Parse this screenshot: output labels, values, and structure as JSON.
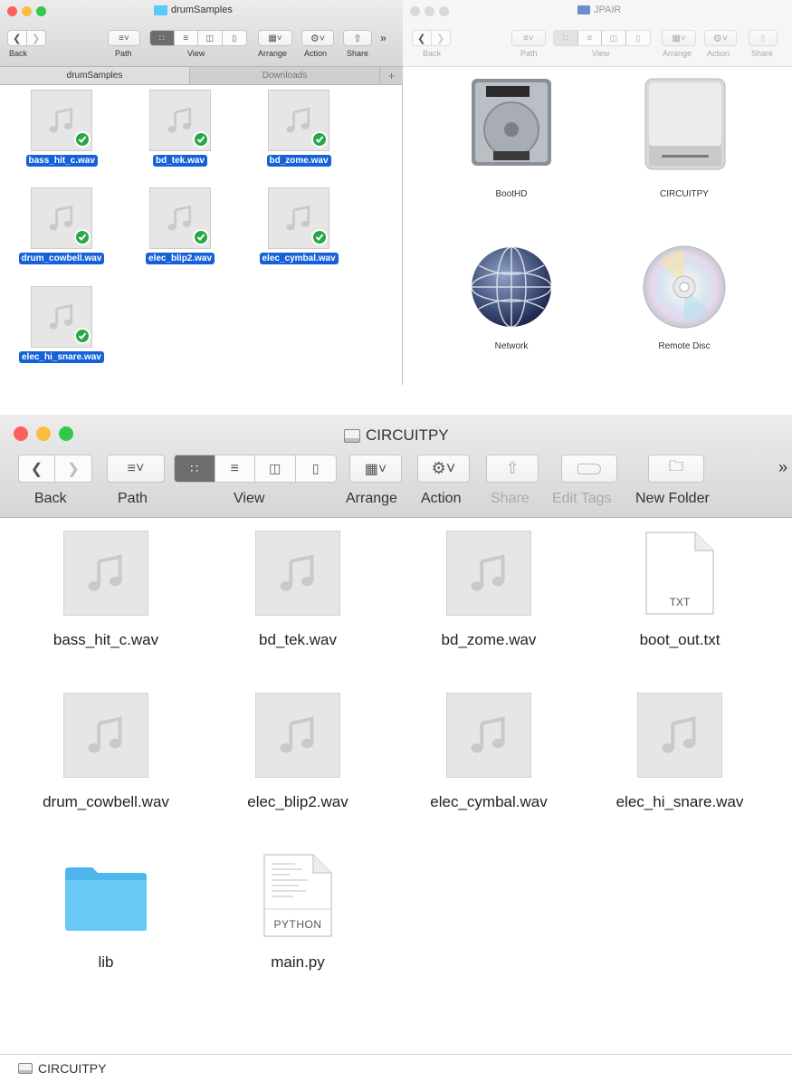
{
  "left_window": {
    "title": "drumSamples",
    "toolbar": {
      "back": "Back",
      "path": "Path",
      "view": "View",
      "arrange": "Arrange",
      "action": "Action",
      "share": "Share"
    },
    "tabs": [
      "drumSamples",
      "Downloads"
    ],
    "files": [
      {
        "name": "bass_hit_c.wav"
      },
      {
        "name": "bd_tek.wav"
      },
      {
        "name": "bd_zome.wav"
      },
      {
        "name": "drum_cowbell.wav"
      },
      {
        "name": "elec_blip2.wav"
      },
      {
        "name": "elec_cymbal.wav"
      },
      {
        "name": "elec_hi_snare.wav"
      }
    ]
  },
  "right_window": {
    "title": "JPAIR",
    "toolbar": {
      "back": "Back",
      "path": "Path",
      "view": "View",
      "arrange": "Arrange",
      "action": "Action",
      "share": "Share"
    },
    "items": [
      {
        "name": "BootHD",
        "icon": "hard-drive-icon"
      },
      {
        "name": "CIRCUITPY",
        "icon": "external-drive-icon"
      },
      {
        "name": "Network",
        "icon": "network-globe-icon"
      },
      {
        "name": "Remote Disc",
        "icon": "optical-disc-icon"
      }
    ]
  },
  "main_window": {
    "title": "CIRCUITPY",
    "toolbar": {
      "back": "Back",
      "path": "Path",
      "view": "View",
      "arrange": "Arrange",
      "action": "Action",
      "share": "Share",
      "edit_tags": "Edit Tags",
      "new_folder": "New Folder"
    },
    "files": [
      {
        "name": "bass_hit_c.wav",
        "type": "audio"
      },
      {
        "name": "bd_tek.wav",
        "type": "audio"
      },
      {
        "name": "bd_zome.wav",
        "type": "audio"
      },
      {
        "name": "boot_out.txt",
        "type": "text",
        "badge": "TXT"
      },
      {
        "name": "drum_cowbell.wav",
        "type": "audio"
      },
      {
        "name": "elec_blip2.wav",
        "type": "audio"
      },
      {
        "name": "elec_cymbal.wav",
        "type": "audio"
      },
      {
        "name": "elec_hi_snare.wav",
        "type": "audio"
      },
      {
        "name": "lib",
        "type": "folder"
      },
      {
        "name": "main.py",
        "type": "python",
        "badge": "PYTHON"
      }
    ],
    "path_bar": "CIRCUITPY"
  },
  "colors": {
    "selection": "#1561d9",
    "check": "#27a745",
    "folder": "#5ac8fa",
    "close": "#fc605c",
    "minimize": "#fdbc40",
    "zoom": "#34c84a"
  }
}
